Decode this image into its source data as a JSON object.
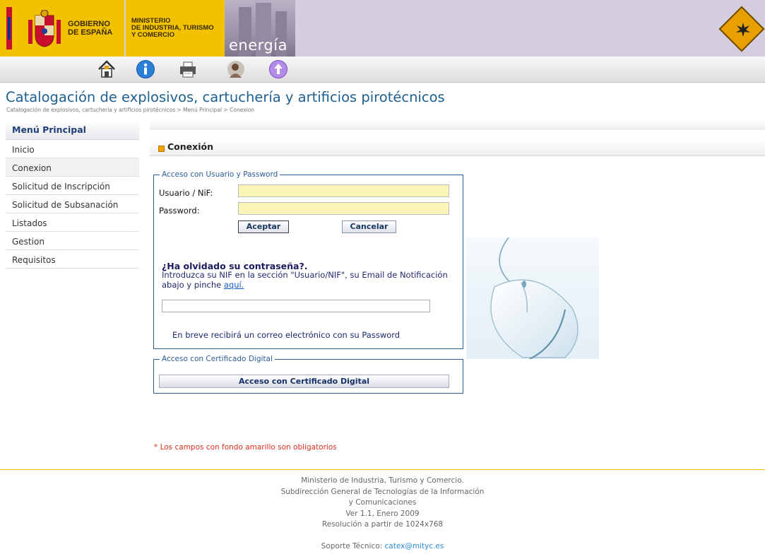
{
  "header": {
    "gobierno": [
      "GOBIERNO",
      "DE ESPAÑA"
    ],
    "ministerio": [
      "MINISTERIO",
      "DE INDUSTRIA, TURISMO",
      "Y COMERCIO"
    ],
    "energia": "energía"
  },
  "toolbar": {
    "icons": [
      "home-icon",
      "info-icon",
      "printer-icon",
      "help-icon",
      "up-icon"
    ]
  },
  "page": {
    "title": "Catalogación de explosivos, cartuchería y artificios pirotécnicos",
    "breadcrumb": "Catalogación de explosivos, cartuchería y artificios pirotécnicos > Menú Principal > Conexion"
  },
  "sidebar": {
    "heading": "Menú Principal",
    "items": [
      {
        "label": "Inicio"
      },
      {
        "label": "Conexion"
      },
      {
        "label": "Solicitud de Inscripción"
      },
      {
        "label": "Solicitud de Subsanación"
      },
      {
        "label": "Listados"
      },
      {
        "label": "Gestion"
      },
      {
        "label": "Requisitos"
      }
    ]
  },
  "main": {
    "section_title": "Conexión",
    "login": {
      "legend": "Acceso con Usuario y Password",
      "user_label": "Usuario / NiF:",
      "user_value": "",
      "password_label": "Password:",
      "password_value": "",
      "accept_label": "Aceptar",
      "cancel_label": "Cancelar",
      "forgot_title": "¿Ha olvidado su contraseña?.",
      "forgot_text": "Introduzca su NIF en la sección \"Usuario/NIF\", su Email de Notificación abajo y pinche ",
      "forgot_link": "aquí.",
      "email_value": "",
      "notice": "En breve recibirá un correo electrónico con su Password"
    },
    "cert": {
      "legend": "Acceso con Certificado Digital",
      "button_label": "Acceso con Certificado Digital"
    },
    "required_note": "* Los campos con fondo amarillo son obligatorios"
  },
  "footer": {
    "lines": [
      "Ministerio de Industria, Turismo y Comercio.",
      "Subdirección General de Tecnologías de la Información",
      "y Comunicaciones",
      "Ver 1.1, Enero 2009",
      "Resolución a partir de 1024x768"
    ],
    "support_label": "Soporte Técnico: ",
    "support_email": "catex@mityc.es"
  },
  "colors": {
    "brand_yellow": "#f2c200",
    "title_blue": "#1d5f8f",
    "required_yellow": "#fbf6b7",
    "required_red": "#e0301e"
  }
}
